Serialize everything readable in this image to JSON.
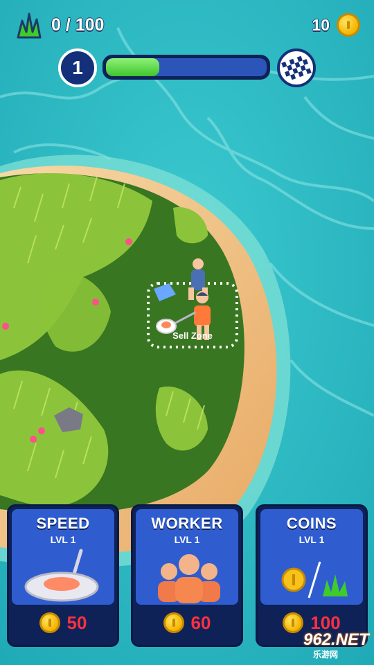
{
  "hud": {
    "grass_counter": "0 / 100",
    "coins": "10",
    "level": "1",
    "level_progress": 0.33
  },
  "world": {
    "sell_zone_label": "Sell Zone"
  },
  "upgrades": [
    {
      "title": "SPEED",
      "level": "LVL 1",
      "price": "50",
      "art": "mower-blade-icon"
    },
    {
      "title": "WORKER",
      "level": "LVL 1",
      "price": "60",
      "art": "workers-icon"
    },
    {
      "title": "COINS",
      "level": "LVL 1",
      "price": "100",
      "art": "coin-to-grass-icon"
    }
  ],
  "watermark": {
    "text": "962.NET",
    "sub": "乐游网"
  },
  "colors": {
    "sea": "#2fbfc6",
    "sand": "#f2c48a",
    "grass": "#5a9a2a",
    "card_bg": "#0f2257",
    "card_inner": "#2f5dd0",
    "price_red": "#ff3040",
    "progress_green": "#3fc52b"
  }
}
